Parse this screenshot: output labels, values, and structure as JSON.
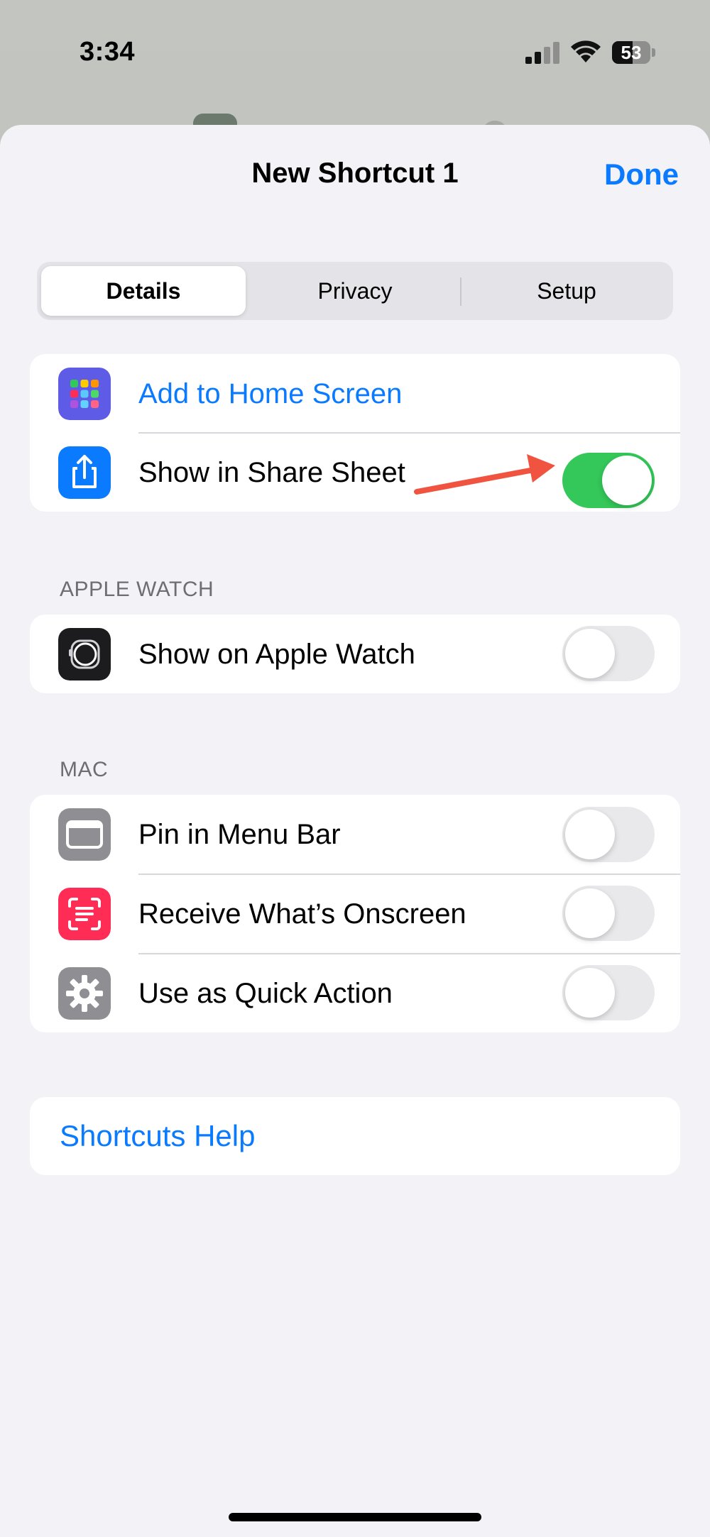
{
  "status_bar": {
    "time": "3:34",
    "battery_percent": "53",
    "battery_level": 0.53,
    "signal_bars": 4,
    "signal_bars_active": 2
  },
  "sheet": {
    "title": "New Shortcut 1",
    "done_label": "Done"
  },
  "segmented": {
    "tabs": [
      {
        "label": "Details",
        "selected": true
      },
      {
        "label": "Privacy",
        "selected": false
      },
      {
        "label": "Setup",
        "selected": false
      }
    ]
  },
  "home_group": {
    "add_to_home_label": "Add to Home Screen",
    "share_sheet_label": "Show in Share Sheet",
    "share_sheet_on": true
  },
  "apple_watch": {
    "header": "APPLE WATCH",
    "show_on_watch_label": "Show on Apple Watch",
    "show_on_watch_on": false
  },
  "mac": {
    "header": "MAC",
    "pin_menu_bar_label": "Pin in Menu Bar",
    "pin_menu_bar_on": false,
    "receive_onscreen_label": "Receive What’s Onscreen",
    "receive_onscreen_on": false,
    "quick_action_label": "Use as Quick Action",
    "quick_action_on": false
  },
  "help": {
    "label": "Shortcuts Help"
  },
  "colors": {
    "accent": "#0a7aff",
    "toggle_on": "#34c759",
    "arrow": "#f0533f",
    "share_icon": "#0a7aff",
    "home_icon": "#5e5ce6",
    "receive_icon": "#ff2d55",
    "gray_icon": "#8e8e93",
    "watch_icon": "#1c1c1e"
  },
  "icons": {
    "add_to_home": "app-grid-icon",
    "share_sheet": "share-icon",
    "apple_watch": "apple-watch-icon",
    "pin_menu_bar": "menu-bar-window-icon",
    "receive_onscreen": "text-scan-icon",
    "quick_action": "gear-icon"
  }
}
